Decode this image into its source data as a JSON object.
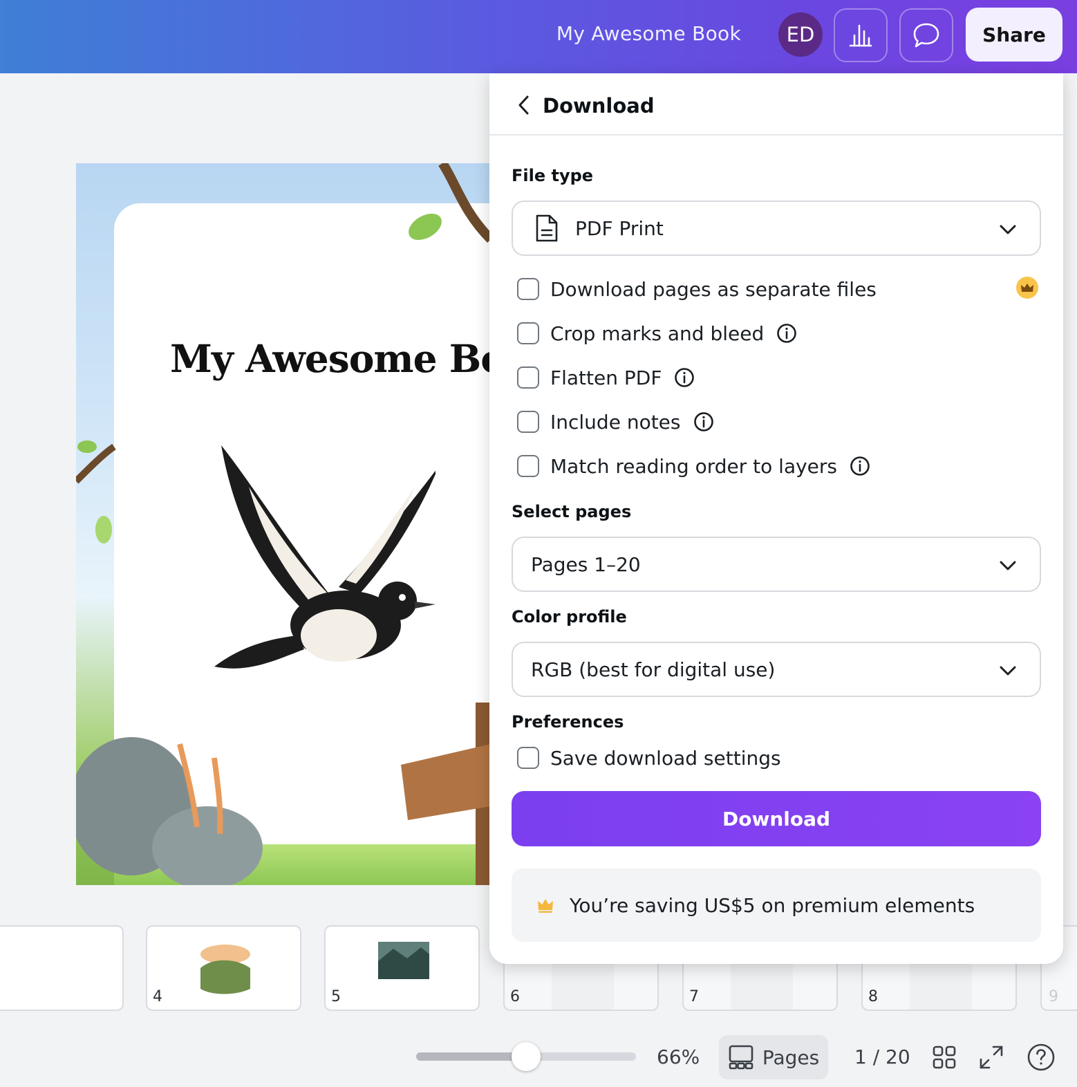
{
  "topbar": {
    "doc_title": "My Awesome Book",
    "avatar_initials": "ED",
    "analytics_icon": "bar-chart-icon",
    "comments_icon": "speech-bubble-icon",
    "share_label": "Share"
  },
  "canvas": {
    "book_title": "My Awesome Book"
  },
  "filmstrip": {
    "pages": [
      "4",
      "5",
      "6",
      "7",
      "8",
      "9"
    ]
  },
  "bottombar": {
    "zoom": "66%",
    "zoom_fraction": 0.5,
    "pages_label": "Pages",
    "page_count": "1 / 20"
  },
  "download_panel": {
    "title": "Download",
    "file_type_label": "File type",
    "file_type_value": "PDF Print",
    "options": [
      {
        "label": "Download pages as separate files",
        "info": false,
        "premium": true
      },
      {
        "label": "Crop marks and bleed",
        "info": true
      },
      {
        "label": "Flatten PDF",
        "info": true
      },
      {
        "label": "Include notes",
        "info": true
      },
      {
        "label": "Match reading order to layers",
        "info": true
      }
    ],
    "select_pages_label": "Select pages",
    "select_pages_value": "Pages 1–20",
    "color_profile_label": "Color profile",
    "color_profile_value": "RGB (best for digital use)",
    "preferences_label": "Preferences",
    "save_settings_label": "Save download settings",
    "download_button": "Download",
    "saving_message": "You’re saving US$5 on premium elements"
  },
  "colors": {
    "accent": "#7b3ff0",
    "avatar": "#5b2a86",
    "crown": "#f8c54a"
  }
}
